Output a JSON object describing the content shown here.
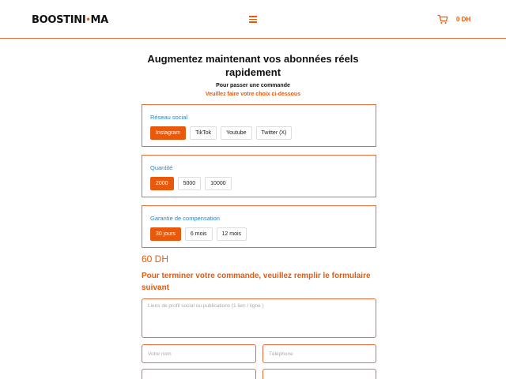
{
  "header": {
    "logo_left": "BOOSTINI",
    "logo_dot": "•",
    "logo_right": "MA",
    "menu_icon": "hamburger-menu-icon",
    "cart_icon": "shopping-cart-icon",
    "cart_total": "0 DH"
  },
  "hero": {
    "title": "Augmentez maintenant vos abonnées réels rapidement",
    "subtitle": "Pour passer une commande",
    "instruction": "Veuillez faire votre choix ci-dessous"
  },
  "social_network": {
    "label": "Réseau social",
    "options": [
      "Instagram",
      "TikTok",
      "Youtube",
      "Twitter (X)"
    ],
    "selected": "Instagram"
  },
  "quantity": {
    "label": "Quantité",
    "options": [
      "2000",
      "5000",
      "10000"
    ],
    "selected": "2000"
  },
  "guarantee": {
    "label": "Garantie de compensation",
    "options": [
      "30 jours",
      "6 mois",
      "12 mois"
    ],
    "selected": "30 jours"
  },
  "price": "60 DH",
  "form": {
    "heading": "Pour terminer votre commande, veuillez remplir le formulaire suivant",
    "links_placeholder": "Liens de profil social ou publications (1 lien / ligne )",
    "name_placeholder": "Votre nom",
    "phone_placeholder": "Téléphone",
    "email_placeholder": "",
    "city_placeholder": ""
  },
  "colors": {
    "accent": "#e8590c",
    "label_blue": "#2b86c8",
    "border": "#e96b3f"
  }
}
